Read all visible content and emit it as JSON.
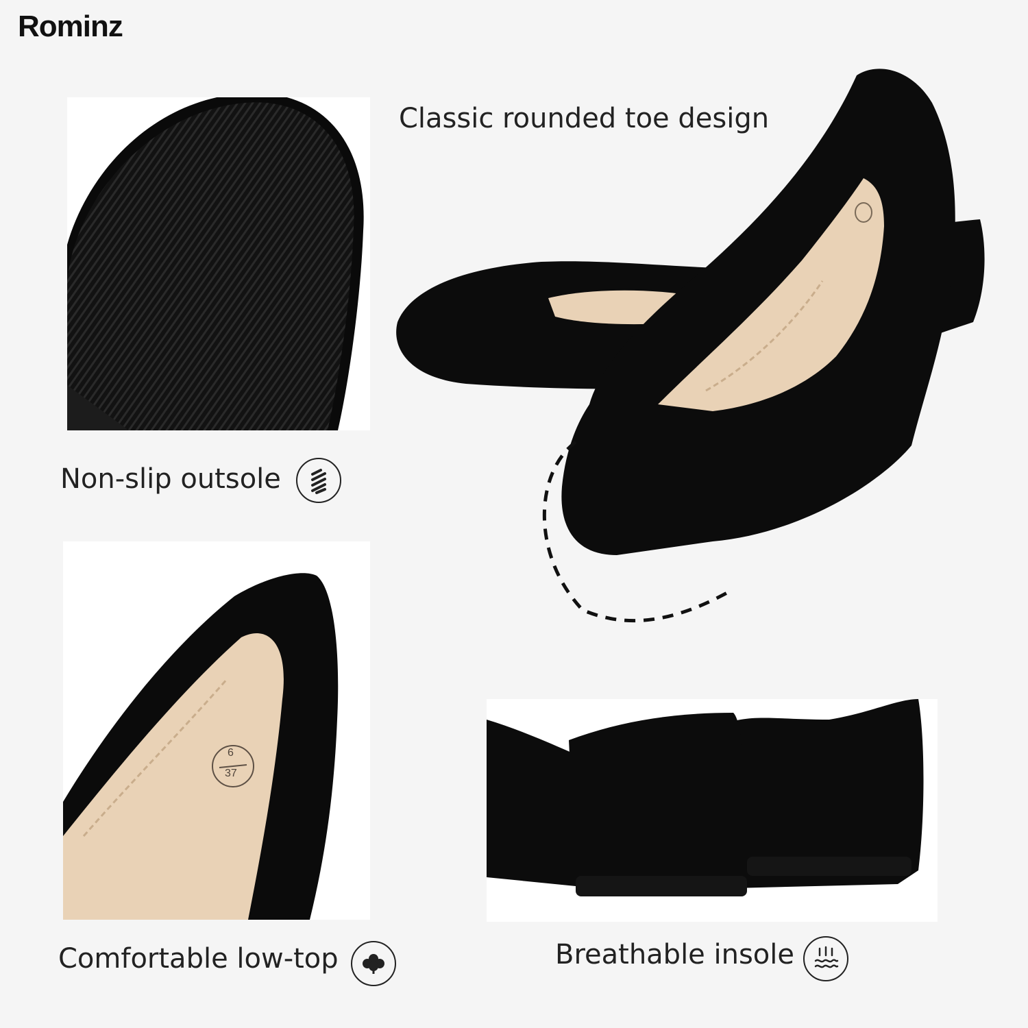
{
  "brand": {
    "name": "Rominz"
  },
  "features": {
    "toe": "Classic rounded toe design",
    "outsole": "Non-slip outsole",
    "comfort": "Comfortable low-top",
    "insole": "Breathable insole"
  },
  "insole_marking": {
    "size_us": "6",
    "size_eu": "37"
  },
  "icons": {
    "outsole": "stripes-icon",
    "comfort": "cotton-icon",
    "insole": "breathable-wave-icon"
  },
  "colors": {
    "background": "#f5f5f5",
    "shoe": "#0c0c0c",
    "insole": "#e9d2b6",
    "text": "#222222"
  }
}
